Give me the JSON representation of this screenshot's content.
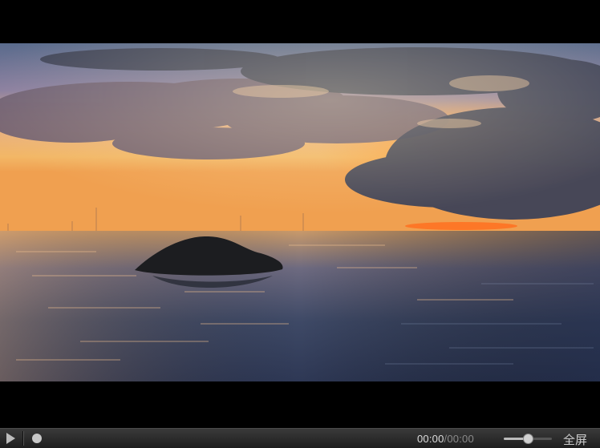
{
  "video": {
    "scene": "sunset-sea-rock"
  },
  "controls": {
    "current_time": "00:00",
    "separator": "/",
    "total_time": "00:00",
    "progress": 0,
    "volume": 0.5,
    "fullscreen_label": "全屏"
  },
  "colors": {
    "controlbar": "#2a2a2a",
    "time_current": "#dddddd",
    "time_total": "#8a8a8a"
  }
}
